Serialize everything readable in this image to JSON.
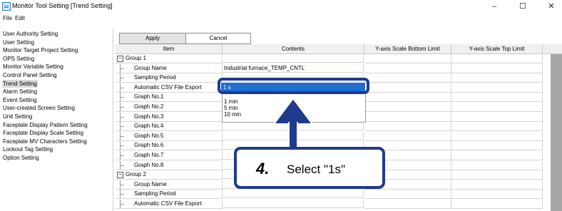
{
  "window": {
    "title": "Monitor Tool Setting [Trend Setting]",
    "controls": {
      "minimize": "–",
      "maximize": "☐",
      "close": "✕"
    }
  },
  "menu": [
    "File",
    "Edit"
  ],
  "sidebar": {
    "items": [
      "User Authority Setting",
      "User Setting",
      "Monitor Target Project Setting",
      "OPS Setting",
      "Monitor Variable Setting",
      "Control Panel Setting",
      "Trend Setting",
      "Alarm Setting",
      "Event Setting",
      "User-created Screen Setting",
      "Unit Setting",
      "Faceplate Display Pattern Setting",
      "Faceplate Display Scale Setting",
      "Faceplate MV Characters Setting",
      "Lockout Tag Setting",
      "Option Setting"
    ],
    "active_index": 6
  },
  "toolbar": {
    "apply": "Apply",
    "cancel": "Cancel"
  },
  "grid": {
    "headers": [
      "Item",
      "Contents",
      "Y-axis Scale Bottom Limit",
      "Y-axis Scale Top Limit"
    ],
    "rows": [
      {
        "item": "Group 1",
        "contents": "",
        "group": true
      },
      {
        "item": "Group Name",
        "contents": "Industrial furnace_TEMP_CNTL"
      },
      {
        "item": "Sampling Period",
        "contents": ""
      },
      {
        "item": "Automatic CSV File Export",
        "contents": ""
      },
      {
        "item": "Graph No.1",
        "contents": ""
      },
      {
        "item": "Graph No.2",
        "contents": ""
      },
      {
        "item": "Graph No.3",
        "contents": ""
      },
      {
        "item": "Graph No.4",
        "contents": ""
      },
      {
        "item": "Graph No.5",
        "contents": ""
      },
      {
        "item": "Graph No.6",
        "contents": ""
      },
      {
        "item": "Graph No.7",
        "contents": ""
      },
      {
        "item": "Graph No.8",
        "contents": ""
      },
      {
        "item": "Group 2",
        "contents": "",
        "group": true
      },
      {
        "item": "Group Name",
        "contents": ""
      },
      {
        "item": "Sampling Period",
        "contents": ""
      },
      {
        "item": "Automatic CSV File Export",
        "contents": ""
      }
    ]
  },
  "dropdown": {
    "selected": "1 s",
    "options": [
      "1 min",
      "5 min",
      "10 min"
    ]
  },
  "callout": {
    "number": "4.",
    "text": "Select \"1s\""
  },
  "colors": {
    "accent": "#1f3a8e",
    "selection": "#1e6fd0",
    "active_nav": "#d9d9d9"
  }
}
